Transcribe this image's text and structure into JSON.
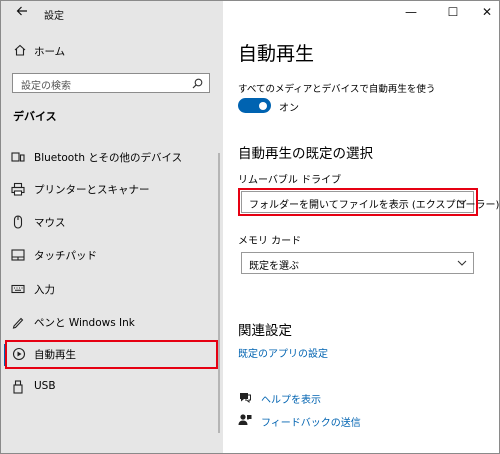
{
  "app": {
    "title": "設定"
  },
  "window_controls": {
    "minimize": "—",
    "maximize": "☐",
    "close": "✕"
  },
  "sidebar": {
    "home_label": "ホーム",
    "search_placeholder": "設定の検索",
    "section_title": "デバイス",
    "items": [
      {
        "label": "Bluetooth とその他のデバイス",
        "icon": "bluetooth-devices-icon"
      },
      {
        "label": "プリンターとスキャナー",
        "icon": "printer-icon"
      },
      {
        "label": "マウス",
        "icon": "mouse-icon"
      },
      {
        "label": "タッチパッド",
        "icon": "touchpad-icon"
      },
      {
        "label": "入力",
        "icon": "keyboard-icon"
      },
      {
        "label": "ペンと Windows Ink",
        "icon": "pen-icon"
      },
      {
        "label": "自動再生",
        "icon": "autoplay-icon",
        "selected": true
      },
      {
        "label": "USB",
        "icon": "usb-icon"
      }
    ]
  },
  "main": {
    "title": "自動再生",
    "autoplay_toggle": {
      "caption": "すべてのメディアとデバイスで自動再生を使う",
      "state_label": "オン",
      "on": true
    },
    "defaults_heading": "自動再生の既定の選択",
    "removable": {
      "label": "リムーバブル ドライブ",
      "value": "フォルダーを開いてファイルを表示 (エクスプローラー)"
    },
    "memory_card": {
      "label": "メモリ カード",
      "value": "既定を選ぶ"
    },
    "related_heading": "関連設定",
    "related_link": "既定のアプリの設定",
    "help_link": "ヘルプを表示",
    "feedback_link": "フィードバックの送信"
  },
  "colors": {
    "accent": "#0063b1",
    "highlight": "#e60012",
    "sidebar_bg": "#e6e6e6"
  }
}
